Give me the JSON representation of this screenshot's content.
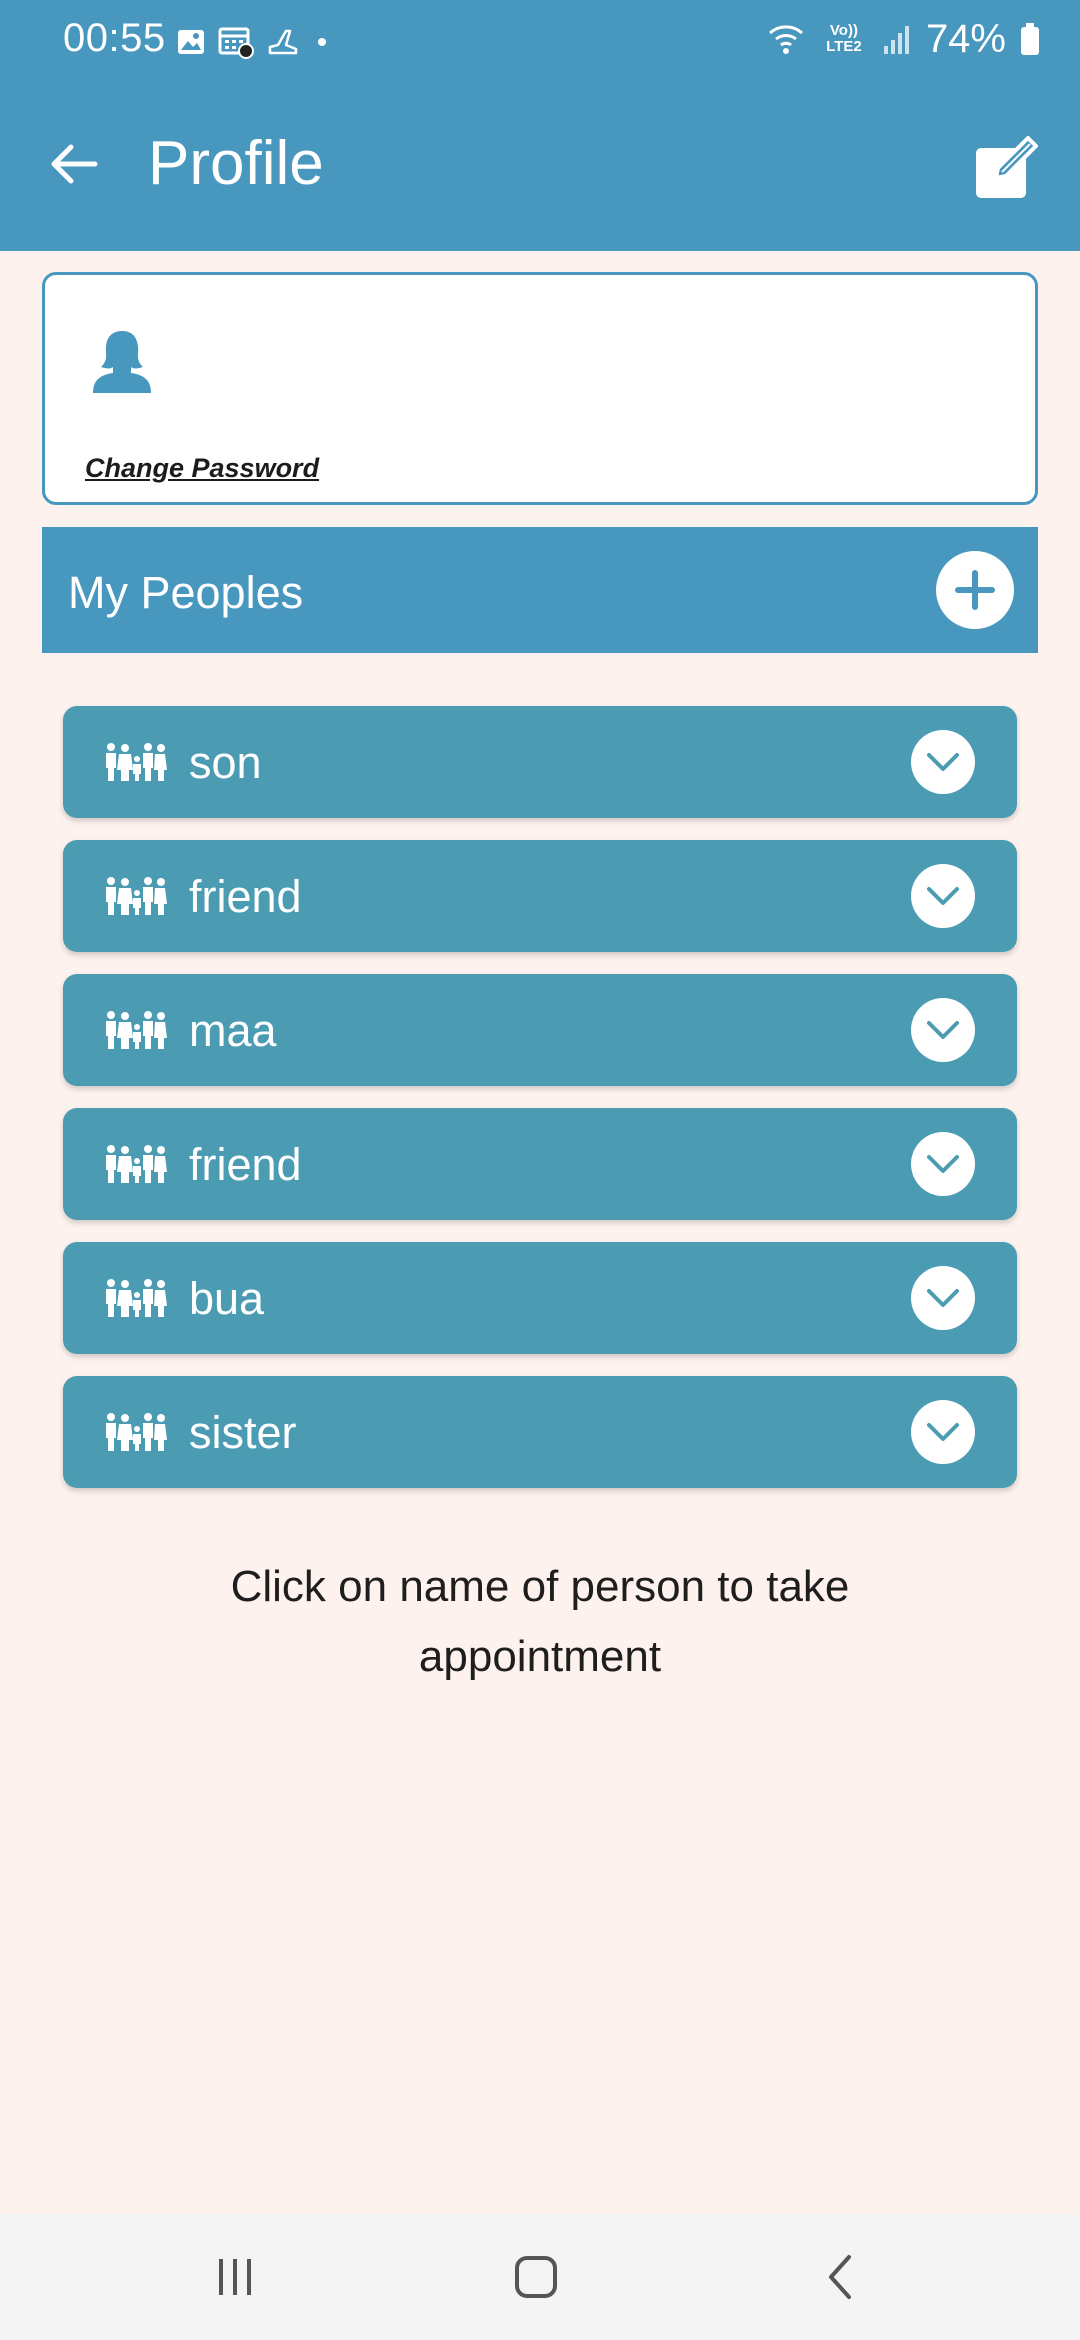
{
  "status_bar": {
    "time": "00:55",
    "network_label": "Vo)) LTE2",
    "battery": "74%"
  },
  "app_bar": {
    "title": "Profile"
  },
  "profile_card": {
    "change_password_label": "Change Password"
  },
  "section": {
    "title": "My Peoples"
  },
  "people": [
    {
      "label": "son"
    },
    {
      "label": "friend"
    },
    {
      "label": "maa"
    },
    {
      "label": "friend"
    },
    {
      "label": "bua"
    },
    {
      "label": "sister"
    }
  ],
  "hint": {
    "text": "Click on name of person to take appointment"
  },
  "colors": {
    "primary": "#4897bf",
    "list_item": "#4b9cb3",
    "background": "#fdf2ee"
  }
}
